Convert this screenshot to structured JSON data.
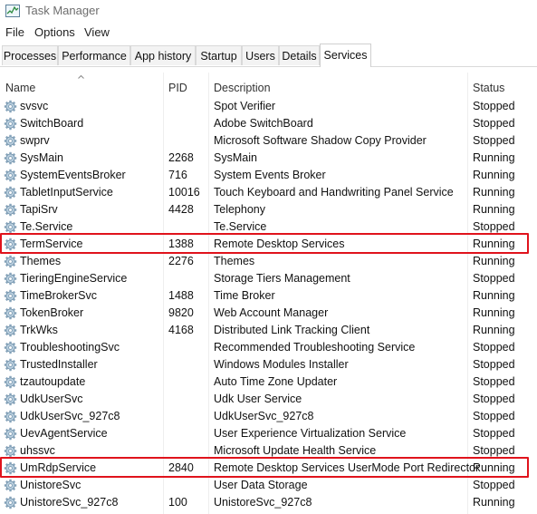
{
  "window": {
    "title": "Task Manager"
  },
  "menu": [
    "File",
    "Options",
    "View"
  ],
  "tabs": [
    "Processes",
    "Performance",
    "App history",
    "Startup",
    "Users",
    "Details",
    "Services"
  ],
  "active_tab": "Services",
  "columns": {
    "name": "Name",
    "pid": "PID",
    "description": "Description",
    "status": "Status"
  },
  "icons": {
    "service": "gear-icon"
  },
  "colors": {
    "highlight": "#e0131c"
  },
  "services": [
    {
      "name": "svsvc",
      "pid": "",
      "description": "Spot Verifier",
      "status": "Stopped"
    },
    {
      "name": "SwitchBoard",
      "pid": "",
      "description": "Adobe SwitchBoard",
      "status": "Stopped"
    },
    {
      "name": "swprv",
      "pid": "",
      "description": "Microsoft Software Shadow Copy Provider",
      "status": "Stopped"
    },
    {
      "name": "SysMain",
      "pid": "2268",
      "description": "SysMain",
      "status": "Running"
    },
    {
      "name": "SystemEventsBroker",
      "pid": "716",
      "description": "System Events Broker",
      "status": "Running"
    },
    {
      "name": "TabletInputService",
      "pid": "10016",
      "description": "Touch Keyboard and Handwriting Panel Service",
      "status": "Running"
    },
    {
      "name": "TapiSrv",
      "pid": "4428",
      "description": "Telephony",
      "status": "Running"
    },
    {
      "name": "Te.Service",
      "pid": "",
      "description": "Te.Service",
      "status": "Stopped"
    },
    {
      "name": "TermService",
      "pid": "1388",
      "description": "Remote Desktop Services",
      "status": "Running",
      "highlighted": true
    },
    {
      "name": "Themes",
      "pid": "2276",
      "description": "Themes",
      "status": "Running"
    },
    {
      "name": "TieringEngineService",
      "pid": "",
      "description": "Storage Tiers Management",
      "status": "Stopped"
    },
    {
      "name": "TimeBrokerSvc",
      "pid": "1488",
      "description": "Time Broker",
      "status": "Running"
    },
    {
      "name": "TokenBroker",
      "pid": "9820",
      "description": "Web Account Manager",
      "status": "Running"
    },
    {
      "name": "TrkWks",
      "pid": "4168",
      "description": "Distributed Link Tracking Client",
      "status": "Running"
    },
    {
      "name": "TroubleshootingSvc",
      "pid": "",
      "description": "Recommended Troubleshooting Service",
      "status": "Stopped"
    },
    {
      "name": "TrustedInstaller",
      "pid": "",
      "description": "Windows Modules Installer",
      "status": "Stopped"
    },
    {
      "name": "tzautoupdate",
      "pid": "",
      "description": "Auto Time Zone Updater",
      "status": "Stopped"
    },
    {
      "name": "UdkUserSvc",
      "pid": "",
      "description": "Udk User Service",
      "status": "Stopped"
    },
    {
      "name": "UdkUserSvc_927c8",
      "pid": "",
      "description": "UdkUserSvc_927c8",
      "status": "Stopped"
    },
    {
      "name": "UevAgentService",
      "pid": "",
      "description": "User Experience Virtualization Service",
      "status": "Stopped"
    },
    {
      "name": "uhssvc",
      "pid": "",
      "description": "Microsoft Update Health Service",
      "status": "Stopped"
    },
    {
      "name": "UmRdpService",
      "pid": "2840",
      "description": "Remote Desktop Services UserMode Port Redirector",
      "status": "Running",
      "highlighted": true
    },
    {
      "name": "UnistoreSvc",
      "pid": "",
      "description": "User Data Storage",
      "status": "Stopped"
    },
    {
      "name": "UnistoreSvc_927c8",
      "pid": "100",
      "description": "UnistoreSvc_927c8",
      "status": "Running"
    }
  ]
}
